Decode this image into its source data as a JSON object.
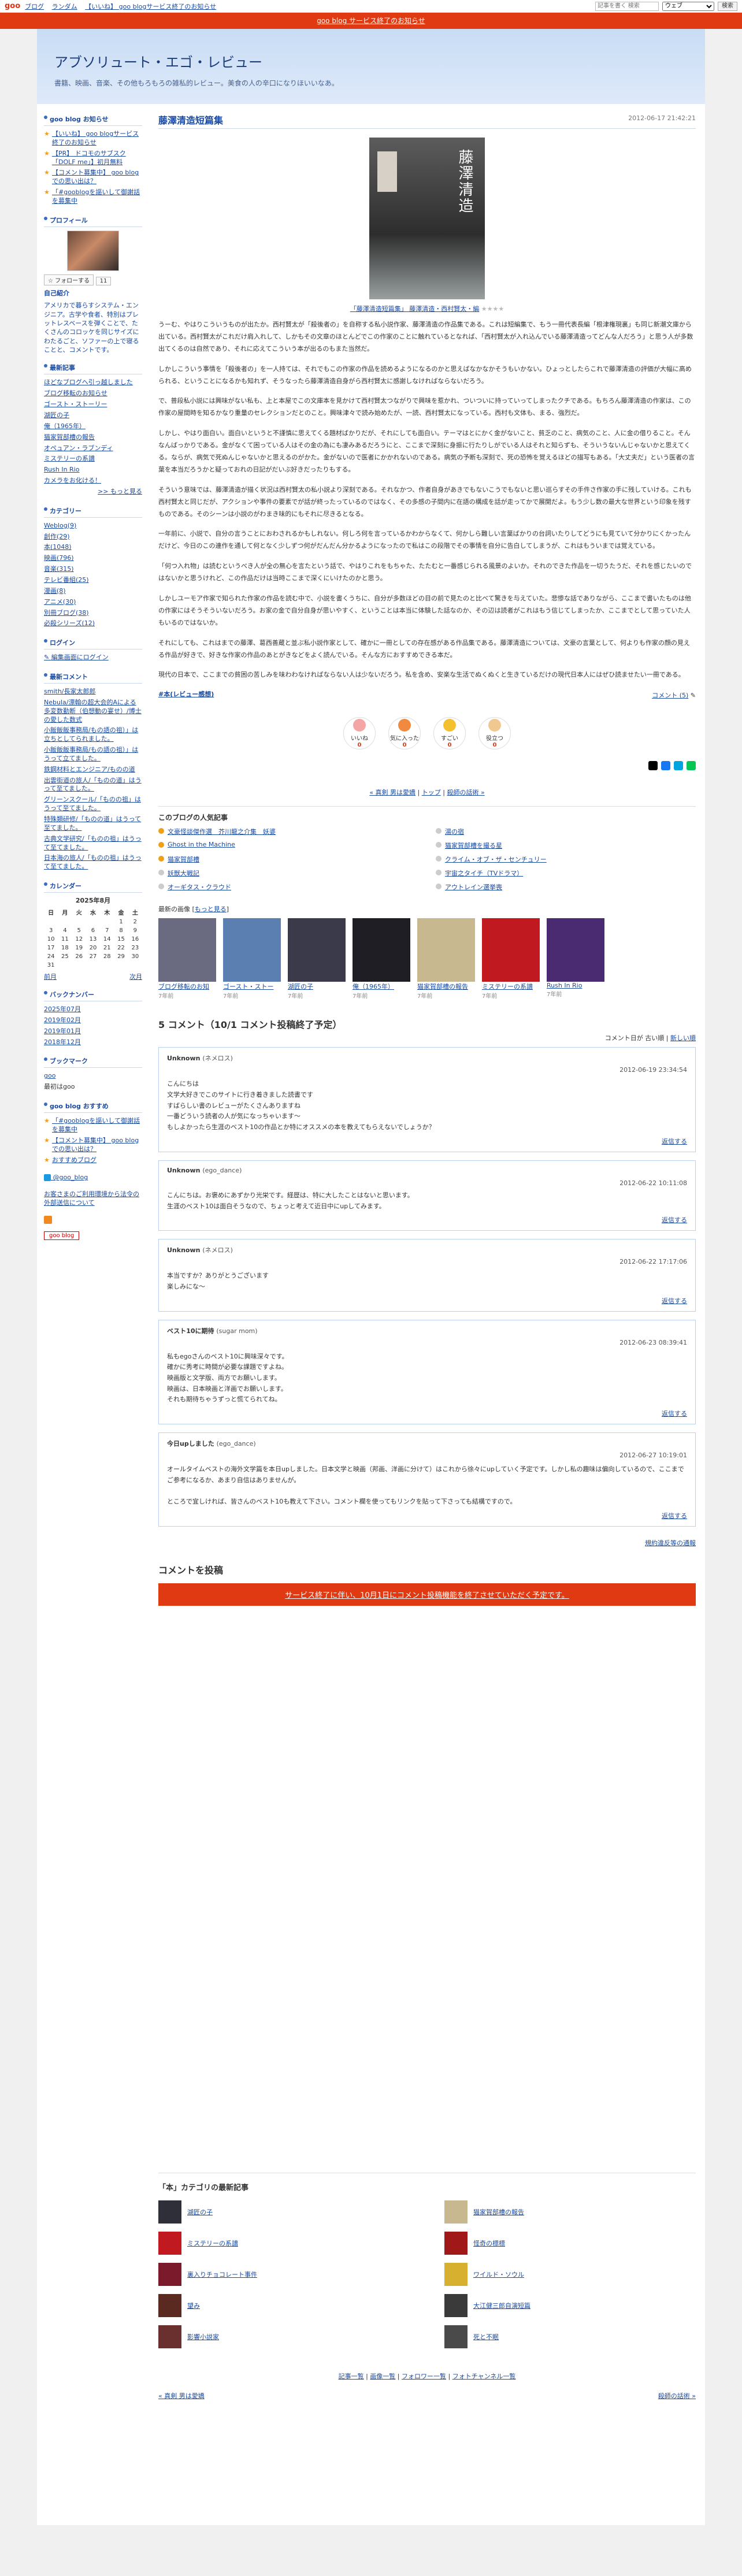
{
  "topbar": {
    "logo": "goo",
    "nav": [
      "ブログ",
      "ランダム",
      "【いいね】 goo blogサービス終了のお知らせ"
    ],
    "search_placeholder": "記事を書く 検索",
    "scope": "ウェブ",
    "search_btn": "検索"
  },
  "redbar": {
    "text": "goo blog サービス終了のお知らせ"
  },
  "header": {
    "title": "アブソリュート・エゴ・レビュー",
    "desc": "書籍、映画、音楽、その他もろもろの雑私的レビュー。美食の人の辛口になりほいいなあ。"
  },
  "sidebar": {
    "notice_head": "goo blog お知らせ",
    "notices": [
      "【いいね】 goo blogサービス終了のお知らせ",
      "【PR】 ドコモのサブスク「DOLF me」】初月無料",
      "【コメント募集中】 goo blogでの思い出は？",
      "「#gooblogを謳いして御謝話を募集中"
    ],
    "profile_head": "プロフィール",
    "follow": "フォローする",
    "follow_count": "11",
    "profile_label": "自己紹介",
    "profile_text": "アメリカで暮らすシステム・エンジニア。古学や食者、特別はプレットレスベースを弾くことで、たくさんのコロッケを同じサイズにわたるごと、ソファーの上で寝ることと、コメントです。",
    "recent_head": "最新記事",
    "recent": [
      "ほどなブログへ引っ越しました",
      "ブログ移転のお知らせ",
      "ゴースト・ストーリー",
      "湖匠の子",
      "俺（1965年）",
      "猫家賀部槽の報告",
      "オペュアン・ラブンディ",
      "ミステリーの系譜",
      "Rush In Rio",
      "カメラをお化ける！"
    ],
    "recent_more": ">> もっと見る",
    "cat_head": "カテゴリー",
    "cats": [
      "Weblog(9)",
      "創作(29)",
      "本(1048)",
      "映画(796)",
      "音楽(315)",
      "テレビ番組(25)",
      "漫画(8)",
      "アニメ(30)",
      "別冊ブログ(38)",
      "必殺シリーズ(12)"
    ],
    "login_head": "ログイン",
    "login": "編集画面にログイン",
    "rc_head": "最新コメント",
    "rc": [
      "smith/長家太郎郎",
      "Nebula/漂翰の超大会的Aによる多変数勤断（伯想動の宴せ）/博士の愛した数式",
      "小飯飯飯事務局/もの語の祖）」は立ちとしてられました。",
      "小飯飯飯事務局/もの語の祖）」はうって立てました。",
      "鉄鋼材料とエンジニア/ものの道",
      "出雲街道の旅人/「ものの道」はうって至てました。",
      "グリーンスクール/「ものの祖」はうって至てました。",
      "特殊類研修/「ものの道」はうって至てました。",
      "古典文学研究/「ものの祖」はうって至てました。",
      "日本海の旅人/「ものの祖」はうって至てました。"
    ],
    "cal_head": "カレンダー",
    "cal_title": "2025年8月",
    "cal_days": [
      "日",
      "月",
      "火",
      "水",
      "木",
      "金",
      "土"
    ],
    "cal_weeks": [
      [
        "",
        "",
        "",
        "",
        "",
        "1",
        "2"
      ],
      [
        "3",
        "4",
        "5",
        "6",
        "7",
        "8",
        "9"
      ],
      [
        "10",
        "11",
        "12",
        "13",
        "14",
        "15",
        "16"
      ],
      [
        "17",
        "18",
        "19",
        "20",
        "21",
        "22",
        "23"
      ],
      [
        "24",
        "25",
        "26",
        "27",
        "28",
        "29",
        "30"
      ],
      [
        "31",
        "",
        "",
        "",
        "",
        "",
        ""
      ]
    ],
    "cal_prev": "前月",
    "cal_next": "次月",
    "bn_head": "バックナンバー",
    "bn": [
      "2025年07月",
      "2019年02月",
      "2019年01月",
      "2018年12月"
    ],
    "bm_head": "ブックマーク",
    "bm": [
      "goo",
      "最初はgoo"
    ],
    "rec_head": "goo blog おすすめ",
    "rec": [
      "「#gooblogを謳いして御謝話を募集中",
      "【コメント募集中】 goo blogでの思い出は？",
      "おすすめブログ"
    ],
    "twitter": "@goo_blog",
    "privacy": "お客さまのご利用環境から法令の外部送信について",
    "gblog": "goo blog"
  },
  "article": {
    "title": "藤澤清造短篇集",
    "date": "2012-06-17 21:42:21",
    "cover_title": "藤澤清造",
    "caption": "「藤澤清造短篇集」 藤澤清造・西村賢太・編",
    "paras": [
      "うーむ、やはりこういうものが出たか。西村賢太が「殺後者の」を自称する私小説作家、藤澤清造の作品集である。これは短編集で、もう一冊代表長編「根津権現裏」も同じ新潮文庫から出ている。西村賢太がこれだけ肩入れして、しかもその文章のほとんどでこの作家のことに触れているとなれば、「西村賢太が入れ込んでいる藤澤清造ってどんな人だろう」と思う人が多数出てくるのは自然であり、それに応えてこういう本が出るのもまた当然だ。",
      "しかしこういう事情を「殺後者の」を一人持ては、それでもこの作家の作品を読めるようになるのかと思えばなかなかそうもいかない。ひょっとしたらこれで藤澤清造の評価が大幅に高められる、ということになるかも知れず、そうなったら藤澤清造自身がら西村賢太に感謝しなければならないだろう。",
      "で、普段私小説には興味がない私も、上と本屋でこの文庫本を見かけて西村賢太つながりで興味を惹かれ、ついついに持っていってしまったクチである。もちろん藤澤清造の作家は、この作家の屋間時を知るかなり重量のセレクションだとのこと。興味津々で読み始めたが、一読、西村賢太になっている。西村も文体も、まる、強烈だ。",
      "しかし、やはり面白い。面白いというと不謹慎に思えてくる題材ばかりだが、それにしても面白い。テーマはとにかく金がないこと、貧乏のこと、病気のこと、人に金の借りること。そんなんばっかりである。金がなくて困っている人はその金の為にも凄みあるだろうにと、ここまで深刻に身振に行たりしがでいる人はそれと知らずも、そういうないんじゃないかと思えてくる。ならが、病気で死ぬんじゃないかと思えるのがかた。金がないので医者にかかれないのである。病気の予断も深刻で、死の恐怖を覚えるほどの描写もある。「大丈夫だ」という医者の言葉を本当だろうかと疑っておれの日記がだいぶ好きだったりもする。",
      "そういう意味では、藤澤清造が描く状況は西村賢太の私小説より深刻である。それなかつ、作者自身があきでもないこうでもないと思い巡らすその手件さ作家の手に残していける。これも西村賢太と同じだが、アクションや事件の要素でが話が終ったっているのではなく、その多感の子間内に在語の構成を話が走ってかで展開だよ。もう少し数の最大な世界という印象を残すものである。そのシーンは小説のがわまき味的にもそれに尽きるとなる。",
      "一年前に、小説で、自分の言うことにおわされるかもしれない。何しろ何を言っているかわからなくて、何かしら難しい言葉ばかりの台詞いたりしてどうにも見ていて分かりにくかったんだけど、今日のこの連作を通して何となく少しずつ何がだんだん分かるようになったので私はこの段階でその事情を自分に告白してしまうが、これはもういまでは覚えている。",
      "「何つ入れ物」は読むというべき人が全の無心を言たという話で、やはりこれをもちゃた、たたむと一番感じられる風景のよいか。それのできた作品を一切うたうだ、それを感じたいのではないかと思うけれど、この作品だけは当時ここまで深くにいけたのかと思う。",
      "しかしユーモア作家で知られた作家の作品を読む中で、小説を書くうちに、自分が多数ほどの目の前で見たのと比べて驚きを与えていた。悲惨な話でありながら、ここまで書いたものは他の作家にはそうそういないだろう。お家の金で自分自身が思いやすく、ということは本当に体験した話なのか、その辺は読者がこれはもう信じてしまったか、ここまでとして思っていた人もいるのではないか。",
      "それにしても、これはまでの藤澤、葛西善蔵と並ぶ私小説作家として、確かに一冊としての存在感がある作品集である。藤澤清造については、文豪の言葉として、何よりも作家の顔の見える作品が好きで、好きな作家の作品のあとがきなどをよく読んでいる。そんな方におすすめできる本だ。",
      "現代の日本で、ここまでの貧困の苦しみを味わわなければならない人は少ないだろう。私を含め、安楽な生活でぬくぬくと生きているだけの現代日本人にはぜひ読ませたい一冊である。"
    ],
    "tag": "#本(レビュー感想)",
    "comments": "コメント (5)",
    "reactions": [
      {
        "label": "いいね",
        "count": "0",
        "color": "#f4a6a6"
      },
      {
        "label": "気に入った",
        "count": "0",
        "color": "#f08a40"
      },
      {
        "label": "すごい",
        "count": "0",
        "color": "#f4c030"
      },
      {
        "label": "役立つ",
        "count": "0",
        "color": "#f0c890"
      }
    ],
    "pager_prev": "« 真剣 男は愛嬌",
    "pager_top": "トップ",
    "pager_next": "殺師の話術 »",
    "popular_head": "このブログの人気記事",
    "popular": [
      "文豪怪談傑作選　芥川龍之介集　妖婆",
      "湯の宿",
      "Ghost in the Machine",
      "猫家賀部槽を撮る星",
      "猫家賀部槽",
      "クライム・オブ・ザ・センチュリー",
      "妖獣大戦記",
      "宇宙之タイチ（TVドラマ）",
      "オーギタス・クラウド",
      "アウトレイン選挙喪"
    ],
    "recent_head": "最新の画像",
    "recent_more": "もっと見る",
    "thumbs": [
      {
        "title": "ブログ移転のお知",
        "sub": "7年前",
        "color": "#6a6a80"
      },
      {
        "title": "ゴースト・ストー",
        "sub": "7年前",
        "color": "#5a7fb0"
      },
      {
        "title": "湖匠の子",
        "sub": "7年前",
        "color": "#3a3a4a"
      },
      {
        "title": "俺（1965年）",
        "sub": "7年前",
        "color": "#1e1e24"
      },
      {
        "title": "猫家賀部槽の報告",
        "sub": "7年前",
        "color": "#c8b890"
      },
      {
        "title": "ミステリーの系譜",
        "sub": "7年前",
        "color": "#c01a20"
      },
      {
        "title": "Rush In Rio",
        "sub": "7年前",
        "color": "#4a2a70"
      }
    ]
  },
  "comments": {
    "head": "5 コメント（10/1 コメント投稿終了予定）",
    "sort": "コメント日が 古い順",
    "sort_new": "新しい順",
    "items": [
      {
        "who": "Unknown",
        "sub": "(ネメロス)",
        "when": "2012-06-19 23:34:54",
        "body": "こんにちは\n文学大好きでこのサイトに行き着きました読書です\nすばらしい書のレビューがたくさんありますね\n一番どういう読者の人が気になっちゃいます〜\nもしよかったら生涯のベスト10の作品とか特にオススメの本を教えてもらえないでしょうか？",
        "reply": "返信する"
      },
      {
        "who": "Unknown",
        "sub": "(ego_dance)",
        "when": "2012-06-22 10:11:08",
        "body": "こんにちは。お褒めにあずかり光栄です。経歴は、特に大したことはないと思います。\n生涯のベスト10は面白そうなので、ちょっと考えて近日中にupしてみます。",
        "reply": "返信する"
      },
      {
        "who": "Unknown",
        "sub": "(ネメロス)",
        "when": "2012-06-22 17:17:06",
        "body": "本当ですか？ありがとうございます\n楽しみにな〜",
        "reply": "返信する"
      },
      {
        "who": "ベスト10に期待",
        "sub": "(sugar mom)",
        "when": "2012-06-23 08:39:41",
        "body": "私もegoさんのベスト10に興味深々です。\n確かに秀考に時間が必要な課題ですよね。\n映画版と文学版、両方でお願いします。\n映画は、日本映画と洋画でお願いします。\nそれも期待ちゃうずっと慌てられてね。",
        "reply": "返信する"
      },
      {
        "who": "今日upしました",
        "sub": "(ego_dance)",
        "when": "2012-06-27 10:19:01",
        "body": "オールタイムベストの海外文学篇を本日upしました。日本文学と映画（邦画、洋画に分けて）はこれから徐々にupしていく予定です。しかし私の趣味は偏向しているので、ここまでご参考になるか、あまり自信はありませんが。\n\nところで宜しければ、皆さんのベスト10も教えて下さい。コメント欄を使ってもリンクを貼って下さっても結構ですので。",
        "reply": "返信する"
      }
    ],
    "policy": "規約違反等の通報",
    "post_head": "コメントを投稿",
    "notice": "サービス終了に伴い、10月1日にコメント投稿機能を終了させていただく予定です。"
  },
  "catbox": {
    "head": "「本」カテゴリの最新記事",
    "items": [
      {
        "title": "湖匠の子",
        "color": "#2f2f3a"
      },
      {
        "title": "猫家賀部槽の報告",
        "color": "#c8b890"
      },
      {
        "title": "ミステリーの系譜",
        "color": "#c01a20"
      },
      {
        "title": "怪奇の標標",
        "color": "#a01818"
      },
      {
        "title": "裏入りチョコレート事件",
        "color": "#7a1a2a"
      },
      {
        "title": "ワイルド・ソウル",
        "color": "#d8b030"
      },
      {
        "title": "望み",
        "color": "#5a2a20"
      },
      {
        "title": "大江健三郎自演短篇",
        "color": "#3a3a3a"
      },
      {
        "title": "影響小説家",
        "color": "#6a3030"
      },
      {
        "title": "死と不眠",
        "color": "#4a4a4a"
      }
    ],
    "links": [
      "記事一覧",
      "画像一覧",
      "フォロワー一覧",
      "フォトチャンネル一覧"
    ],
    "prev": "« 真剣 男は愛嬌",
    "next": "殺師の話術 »"
  }
}
